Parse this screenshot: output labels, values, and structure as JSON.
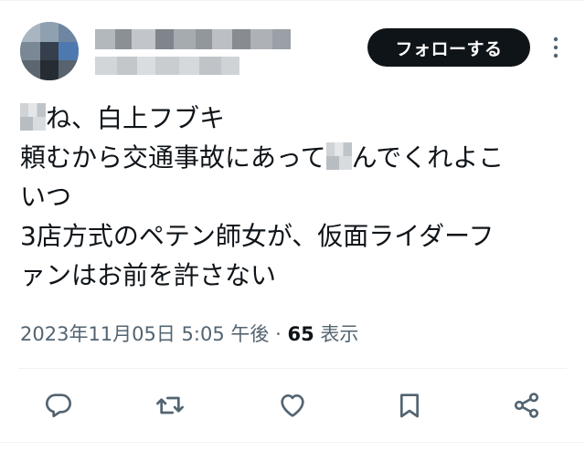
{
  "author": {
    "display_name": "■■■■■■■■■■■■",
    "handle": "@■■■■■■■■■■■"
  },
  "header": {
    "follow_label": "フォローする",
    "more_icon": "more-vertical-icon"
  },
  "tweet": {
    "redaction_1": "■",
    "line1_rest": "ね、白上フブキ",
    "line2_before": "頼むから交通事故にあって",
    "redaction_2": "■",
    "line2_after": "んでくれよこ",
    "line3": "いつ",
    "line4": "3店方式のペテン師女が、仮面ライダーフ",
    "line5": "ァンはお前を許さない"
  },
  "meta": {
    "timestamp": "2023年11月05日 5:05 午後",
    "separator": "·",
    "views_count": "65",
    "views_label": "表示"
  },
  "actions": [
    {
      "name": "reply",
      "icon": "reply-icon"
    },
    {
      "name": "retweet",
      "icon": "retweet-icon"
    },
    {
      "name": "like",
      "icon": "heart-icon"
    },
    {
      "name": "bookmark",
      "icon": "bookmark-icon"
    },
    {
      "name": "share",
      "icon": "share-icon"
    }
  ],
  "colors": {
    "text_primary": "#0f1419",
    "text_secondary": "#536471",
    "follow_button_bg": "#0f1419",
    "follow_button_text": "#ffffff",
    "divider": "#eff3f4"
  }
}
